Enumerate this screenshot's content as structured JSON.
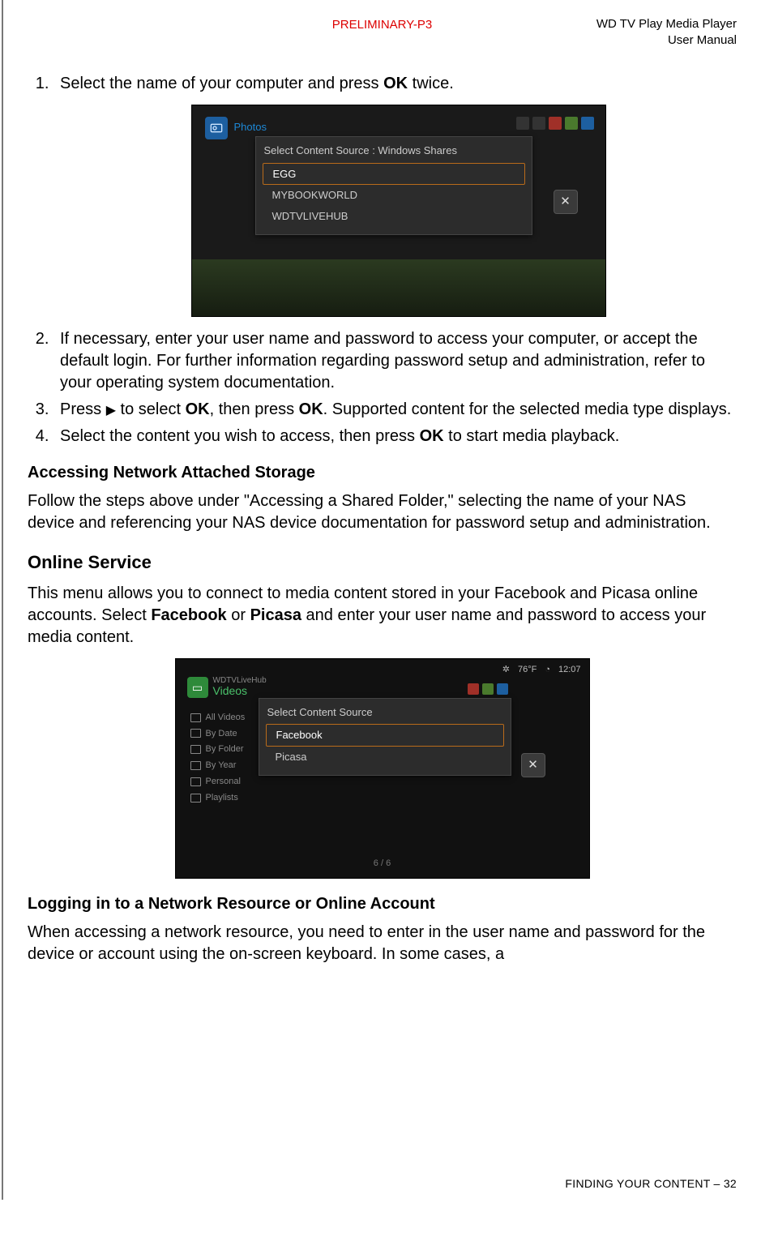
{
  "header": {
    "preliminary": "PRELIMINARY-P3",
    "title_line1": "WD TV Play Media Player",
    "title_line2": "User Manual"
  },
  "step1": {
    "pre": "Select the name of your computer and press ",
    "bold": "OK",
    "post": " twice."
  },
  "fig1": {
    "photos_label": "Photos",
    "popup_title": "Select Content Source : Windows Shares",
    "items": [
      "EGG",
      "MYBOOKWORLD",
      "WDTVLIVEHUB"
    ],
    "close": "✕"
  },
  "step2": "If necessary, enter your user name and password to access your computer, or accept the default login. For further information regarding password setup and administration, refer to your operating system documentation.",
  "step3": {
    "p1": "Press ",
    "arrow": "▶",
    "p2": " to select ",
    "b1": "OK",
    "p3": ", then press ",
    "b2": "OK",
    "p4": ". Supported content for the selected media type displays."
  },
  "step4": {
    "p1": "Select the content you wish to access, then press ",
    "b1": "OK",
    "p2": " to start media playback."
  },
  "sec_nas_title": "Accessing Network Attached Storage",
  "sec_nas_text": "Follow the steps above under \"Accessing a Shared Folder,\" selecting the name of your NAS device and referencing your NAS device documentation for password setup and administration.",
  "sec_online_title": "Online Service",
  "sec_online": {
    "p1": "This menu allows you to connect to media content stored in your Facebook and Picasa online accounts. Select ",
    "b1": "Facebook",
    "p2": " or ",
    "b2": "Picasa",
    "p3": " and enter your user name and password to access your media content."
  },
  "fig2": {
    "status_temp": "76°F",
    "status_time": "12:07",
    "breadcrumb_small": "WDTVLiveHub",
    "breadcrumb_main": "Videos",
    "leftnav": [
      "All Videos",
      "By Date",
      "By Folder",
      "By Year",
      "Personal",
      "Playlists"
    ],
    "popup_title": "Select Content Source",
    "items": [
      "Facebook",
      "Picasa"
    ],
    "close": "✕",
    "pager": "6 / 6"
  },
  "sec_login_title": "Logging in to a Network Resource or Online Account",
  "sec_login_text": "When accessing a network resource, you need to enter in the user name and password for the device or account using the on-screen keyboard. In some cases, a",
  "footer": {
    "text": "FINDING YOUR CONTENT – ",
    "page": "32"
  }
}
